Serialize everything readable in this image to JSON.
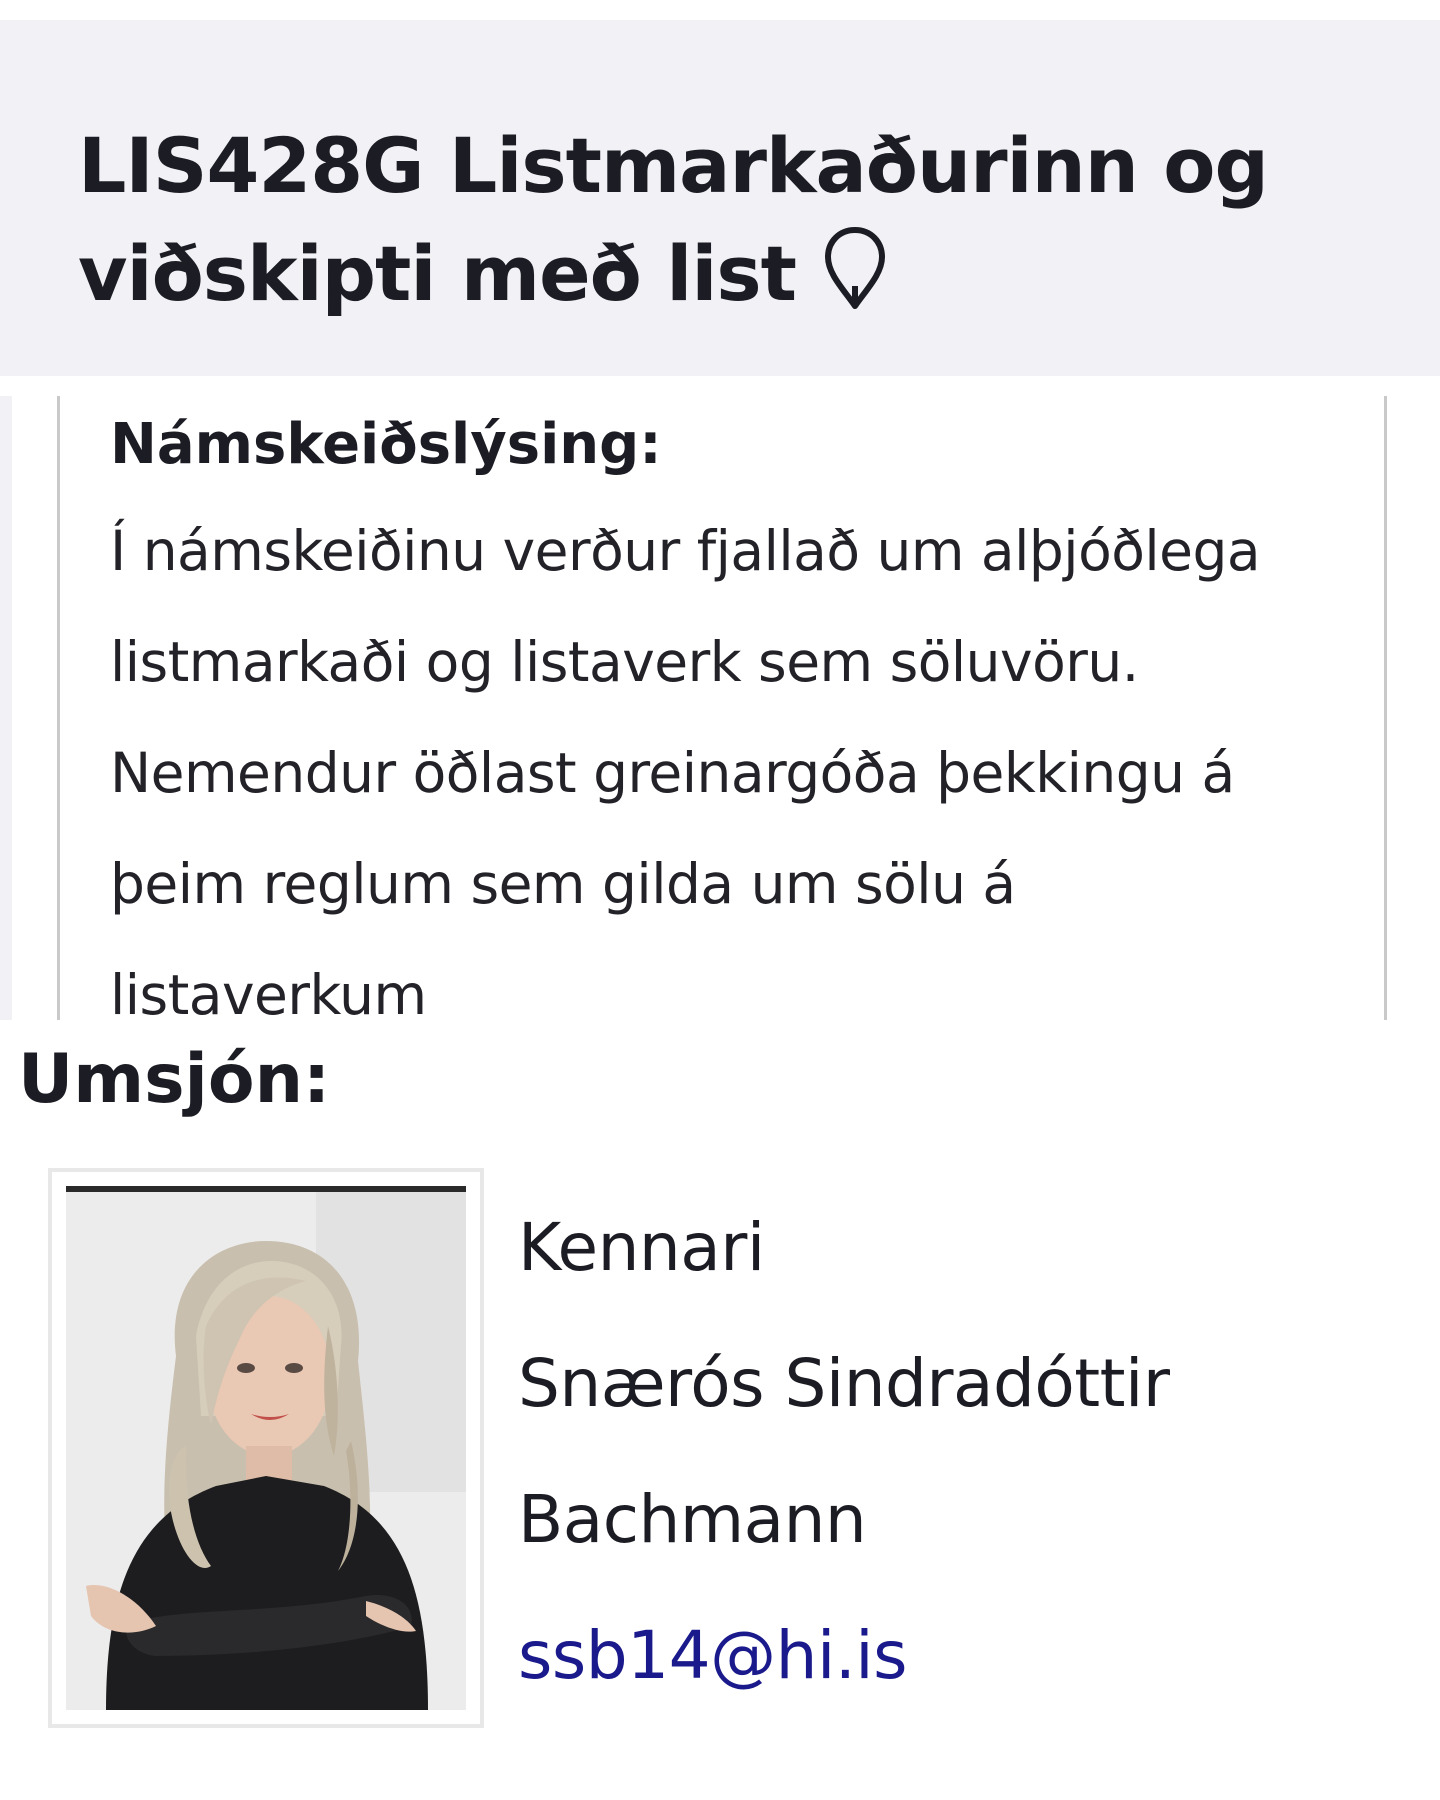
{
  "course": {
    "title": "LIS428G Listmarkaðurinn og viðskipti með list",
    "location_icon": "map-pin-icon"
  },
  "description": {
    "heading": "Námskeiðslýsing:",
    "text": "Í námskeiðinu verður fjallað um alþjóðlega listmarkaði og listaverk sem söluvöru. Nemendur öðlast greinargóða þekkingu á þeim reglum sem gilda um sölu á listaverkum"
  },
  "supervision": {
    "heading": "Umsjón:",
    "role": "Kennari",
    "name": "Snærós Sindradóttir Bachmann",
    "email": "ssb14@hi.is"
  },
  "colors": {
    "header_bg": "#f1f1f6",
    "text": "#1c1c24",
    "link": "#1a1a8c",
    "panel_border": "#c9c9c9"
  }
}
